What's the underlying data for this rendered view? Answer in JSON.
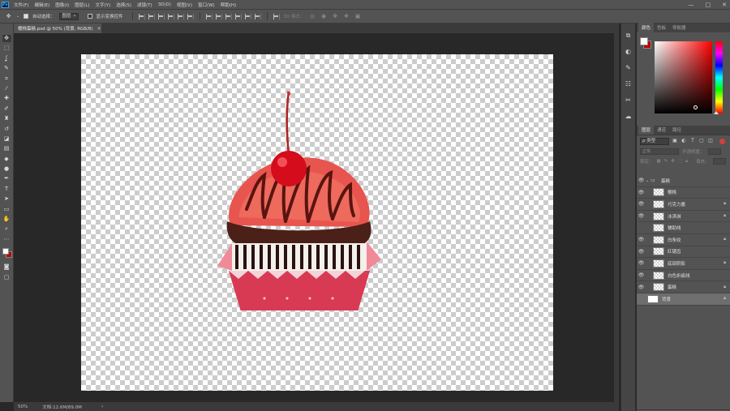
{
  "app": {
    "logo": "Ps"
  },
  "menu": [
    "文件(F)",
    "编辑(E)",
    "图像(I)",
    "图层(L)",
    "文字(Y)",
    "选择(S)",
    "滤镜(T)",
    "3D(D)",
    "视图(V)",
    "窗口(W)",
    "帮助(H)"
  ],
  "window_controls": {
    "minimize": "—",
    "maximize": "□",
    "close": "✕"
  },
  "options": {
    "auto_select_label": "自动选择：",
    "auto_select_value": "图层",
    "transform_label": "显示变换控件",
    "mode3d_label": "3D 模式："
  },
  "document": {
    "tab_title": "樱桃蛋糕.psd @ 50% (背景, RGB/8)",
    "tab_close": "✕"
  },
  "status": {
    "zoom": "50%",
    "doc_size": "文档:12.6M/89.0M",
    "arrow": "›"
  },
  "tools": [
    {
      "name": "move-tool",
      "glyph": "✥"
    },
    {
      "name": "marquee-tool",
      "glyph": "⬚"
    },
    {
      "name": "lasso-tool",
      "glyph": "ʆ"
    },
    {
      "name": "quick-select-tool",
      "glyph": "✎"
    },
    {
      "name": "crop-tool",
      "glyph": "⌗"
    },
    {
      "name": "eyedropper-tool",
      "glyph": "⁄"
    },
    {
      "name": "healing-brush-tool",
      "glyph": "✚"
    },
    {
      "name": "brush-tool",
      "glyph": "✐"
    },
    {
      "name": "clone-stamp-tool",
      "glyph": "♜"
    },
    {
      "name": "history-brush-tool",
      "glyph": "↺"
    },
    {
      "name": "eraser-tool",
      "glyph": "◪"
    },
    {
      "name": "gradient-tool",
      "glyph": "▤"
    },
    {
      "name": "blur-tool",
      "glyph": "◆"
    },
    {
      "name": "dodge-tool",
      "glyph": "●"
    },
    {
      "name": "pen-tool",
      "glyph": "✒"
    },
    {
      "name": "type-tool",
      "glyph": "T"
    },
    {
      "name": "path-select-tool",
      "glyph": "➤"
    },
    {
      "name": "rectangle-tool",
      "glyph": "▭"
    },
    {
      "name": "hand-tool",
      "glyph": "✋"
    },
    {
      "name": "zoom-tool",
      "glyph": "⌕"
    },
    {
      "name": "more-tools",
      "glyph": "⋯"
    }
  ],
  "colors": {
    "foreground": "#ffffff",
    "background": "#b80000"
  },
  "color_panel": {
    "tabs": [
      "颜色",
      "色板",
      "导航器"
    ]
  },
  "layers_panel": {
    "tabs": [
      "图层",
      "通道",
      "路径"
    ],
    "filter_label": "ρ 类型",
    "blend_mode": "正常",
    "opacity_label": "不透明度：",
    "lock_label": "锁定：",
    "fill_label": "填充：",
    "layers": [
      {
        "name": "蛋糕",
        "type": "group",
        "visible": true,
        "locked": false,
        "thumb": "folder"
      },
      {
        "name": "樱桃",
        "type": "layer",
        "visible": true,
        "locked": false,
        "thumb": "checker",
        "indent": true
      },
      {
        "name": "巧克力酱",
        "type": "layer",
        "visible": true,
        "locked": true,
        "thumb": "checker",
        "indent": true
      },
      {
        "name": "冰淇淋",
        "type": "layer",
        "visible": true,
        "locked": true,
        "thumb": "checker",
        "indent": true
      },
      {
        "name": "辅助线",
        "type": "layer",
        "visible": false,
        "locked": false,
        "thumb": "checker",
        "indent": true
      },
      {
        "name": "白条纹",
        "type": "layer",
        "visible": true,
        "locked": true,
        "thumb": "checker",
        "indent": true
      },
      {
        "name": "红锯齿",
        "type": "layer",
        "visible": true,
        "locked": false,
        "thumb": "checker",
        "indent": true
      },
      {
        "name": "底部阴影",
        "type": "layer",
        "visible": true,
        "locked": true,
        "thumb": "checker",
        "indent": true
      },
      {
        "name": "白色折痕线",
        "type": "layer",
        "visible": true,
        "locked": false,
        "thumb": "checker",
        "indent": true
      },
      {
        "name": "蛋糕",
        "type": "layer",
        "visible": true,
        "locked": true,
        "thumb": "checker",
        "indent": true
      },
      {
        "name": "背景",
        "type": "layer",
        "visible": false,
        "locked": true,
        "thumb": "white",
        "selected": true
      }
    ]
  }
}
